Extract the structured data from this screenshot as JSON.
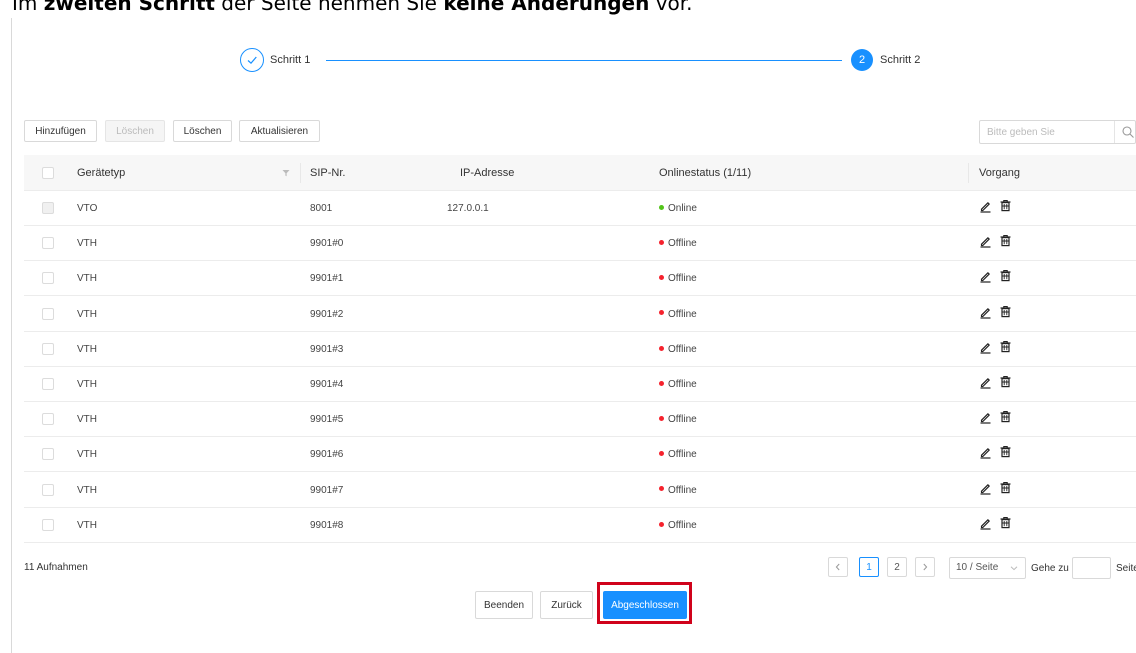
{
  "doc_text": {
    "part1": "Im ",
    "bold1": "zweiten Schritt",
    "part2": " der Seite nehmen Sie ",
    "bold2": "keine Änderungen",
    "part3": " vor."
  },
  "steps": [
    {
      "label": "Schritt 1",
      "status": "done"
    },
    {
      "number": "2",
      "label": "Schritt 2",
      "status": "active"
    }
  ],
  "toolbar": {
    "add": "Hinzufügen",
    "delete_disabled": "Löschen",
    "delete": "Löschen",
    "refresh": "Aktualisieren",
    "search_placeholder": "Bitte geben Sie"
  },
  "table": {
    "headers": {
      "device_type": "Gerätetyp",
      "sip": "SIP-Nr.",
      "ip": "IP-Adresse",
      "status": "Onlinestatus (1/11)",
      "action": "Vorgang"
    },
    "rows": [
      {
        "type": "VTO",
        "sip": "8001",
        "ip": "127.0.0.1",
        "status": "Online",
        "status_color": "#52c41a"
      },
      {
        "type": "VTH",
        "sip": "9901#0",
        "ip": "",
        "status": "Offline",
        "status_color": "#f5222d"
      },
      {
        "type": "VTH",
        "sip": "9901#1",
        "ip": "",
        "status": "Offline",
        "status_color": "#f5222d"
      },
      {
        "type": "VTH",
        "sip": "9901#2",
        "ip": "",
        "status": "Offline",
        "status_color": "#f5222d"
      },
      {
        "type": "VTH",
        "sip": "9901#3",
        "ip": "",
        "status": "Offline",
        "status_color": "#f5222d"
      },
      {
        "type": "VTH",
        "sip": "9901#4",
        "ip": "",
        "status": "Offline",
        "status_color": "#f5222d"
      },
      {
        "type": "VTH",
        "sip": "9901#5",
        "ip": "",
        "status": "Offline",
        "status_color": "#f5222d"
      },
      {
        "type": "VTH",
        "sip": "9901#6",
        "ip": "",
        "status": "Offline",
        "status_color": "#f5222d"
      },
      {
        "type": "VTH",
        "sip": "9901#7",
        "ip": "",
        "status": "Offline",
        "status_color": "#f5222d"
      },
      {
        "type": "VTH",
        "sip": "9901#8",
        "ip": "",
        "status": "Offline",
        "status_color": "#f5222d"
      }
    ]
  },
  "footer": {
    "records": "11 Aufnahmen",
    "pages": [
      "1",
      "2"
    ],
    "current_page": "1",
    "page_size": "10 / Seite",
    "goto": "Gehe zu",
    "page_suffix": "Seite"
  },
  "actions": {
    "finish": "Beenden",
    "back": "Zurück",
    "completed": "Abgeschlossen"
  },
  "colors": {
    "accent": "#1890ff",
    "highlight": "#d0021b",
    "online": "#52c41a",
    "offline": "#f5222d"
  }
}
